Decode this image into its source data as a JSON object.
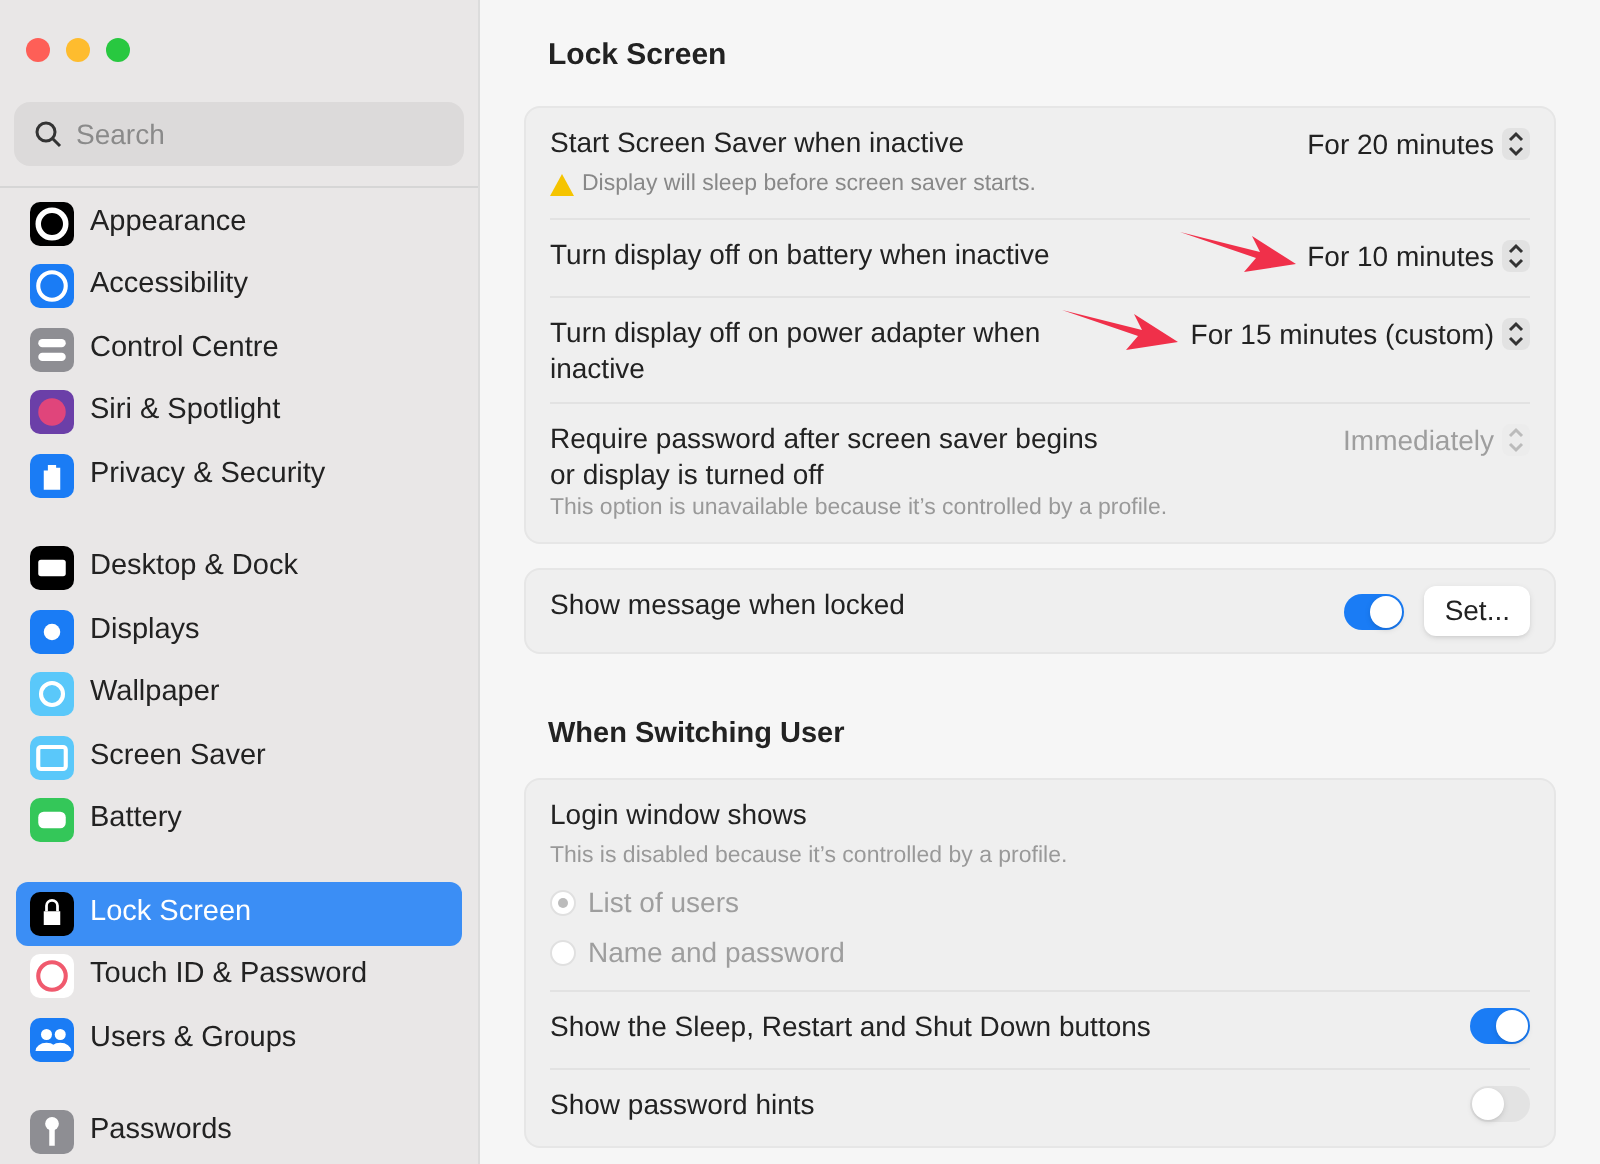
{
  "search": {
    "placeholder": "Search"
  },
  "sidebar": {
    "groups": [
      [
        {
          "label": "Appearance",
          "selected": false
        },
        {
          "label": "Accessibility",
          "selected": false
        },
        {
          "label": "Control Centre",
          "selected": false
        },
        {
          "label": "Siri & Spotlight",
          "selected": false
        },
        {
          "label": "Privacy & Security",
          "selected": false
        }
      ],
      [
        {
          "label": "Desktop & Dock",
          "selected": false
        },
        {
          "label": "Displays",
          "selected": false
        },
        {
          "label": "Wallpaper",
          "selected": false
        },
        {
          "label": "Screen Saver",
          "selected": false
        },
        {
          "label": "Battery",
          "selected": false
        }
      ],
      [
        {
          "label": "Lock Screen",
          "selected": true
        },
        {
          "label": "Touch ID & Password",
          "selected": false
        },
        {
          "label": "Users & Groups",
          "selected": false
        }
      ],
      [
        {
          "label": "Passwords",
          "selected": false
        }
      ]
    ]
  },
  "title": "Lock Screen",
  "sections": [
    {
      "rows": [
        {
          "kind": "popup",
          "label": "Start Screen Saver when inactive",
          "value": "For 20 minutes",
          "warning": "Display will sleep before screen saver starts.",
          "disabled": false,
          "arrow": false
        },
        {
          "kind": "popup",
          "label": "Turn display off on battery when inactive",
          "value": "For 10 minutes",
          "disabled": false,
          "arrow": true
        },
        {
          "kind": "popup",
          "label": "Turn display off on power adapter when inactive",
          "value": "For 15 minutes (custom)",
          "disabled": false,
          "arrow": true
        },
        {
          "kind": "popup",
          "label": "Require password after screen saver begins or display is turned off",
          "value": "Immediately",
          "note": "This option is unavailable because it’s controlled by a profile.",
          "disabled": true,
          "arrow": false
        }
      ]
    },
    {
      "rows": [
        {
          "kind": "toggle",
          "label": "Show message when locked",
          "on": true,
          "button": "Set..."
        }
      ]
    },
    {
      "heading": "When Switching User",
      "rows": [
        {
          "kind": "radio",
          "label": "Login window shows",
          "note": "This is disabled because it’s controlled by a profile.",
          "disabled": true,
          "options": [
            {
              "label": "List of users",
              "selected": true
            },
            {
              "label": "Name and password",
              "selected": false
            }
          ]
        },
        {
          "kind": "toggle",
          "label": "Show the Sleep, Restart and Shut Down buttons",
          "on": true
        },
        {
          "kind": "toggle",
          "label": "Show password hints",
          "on": false
        }
      ]
    }
  ]
}
